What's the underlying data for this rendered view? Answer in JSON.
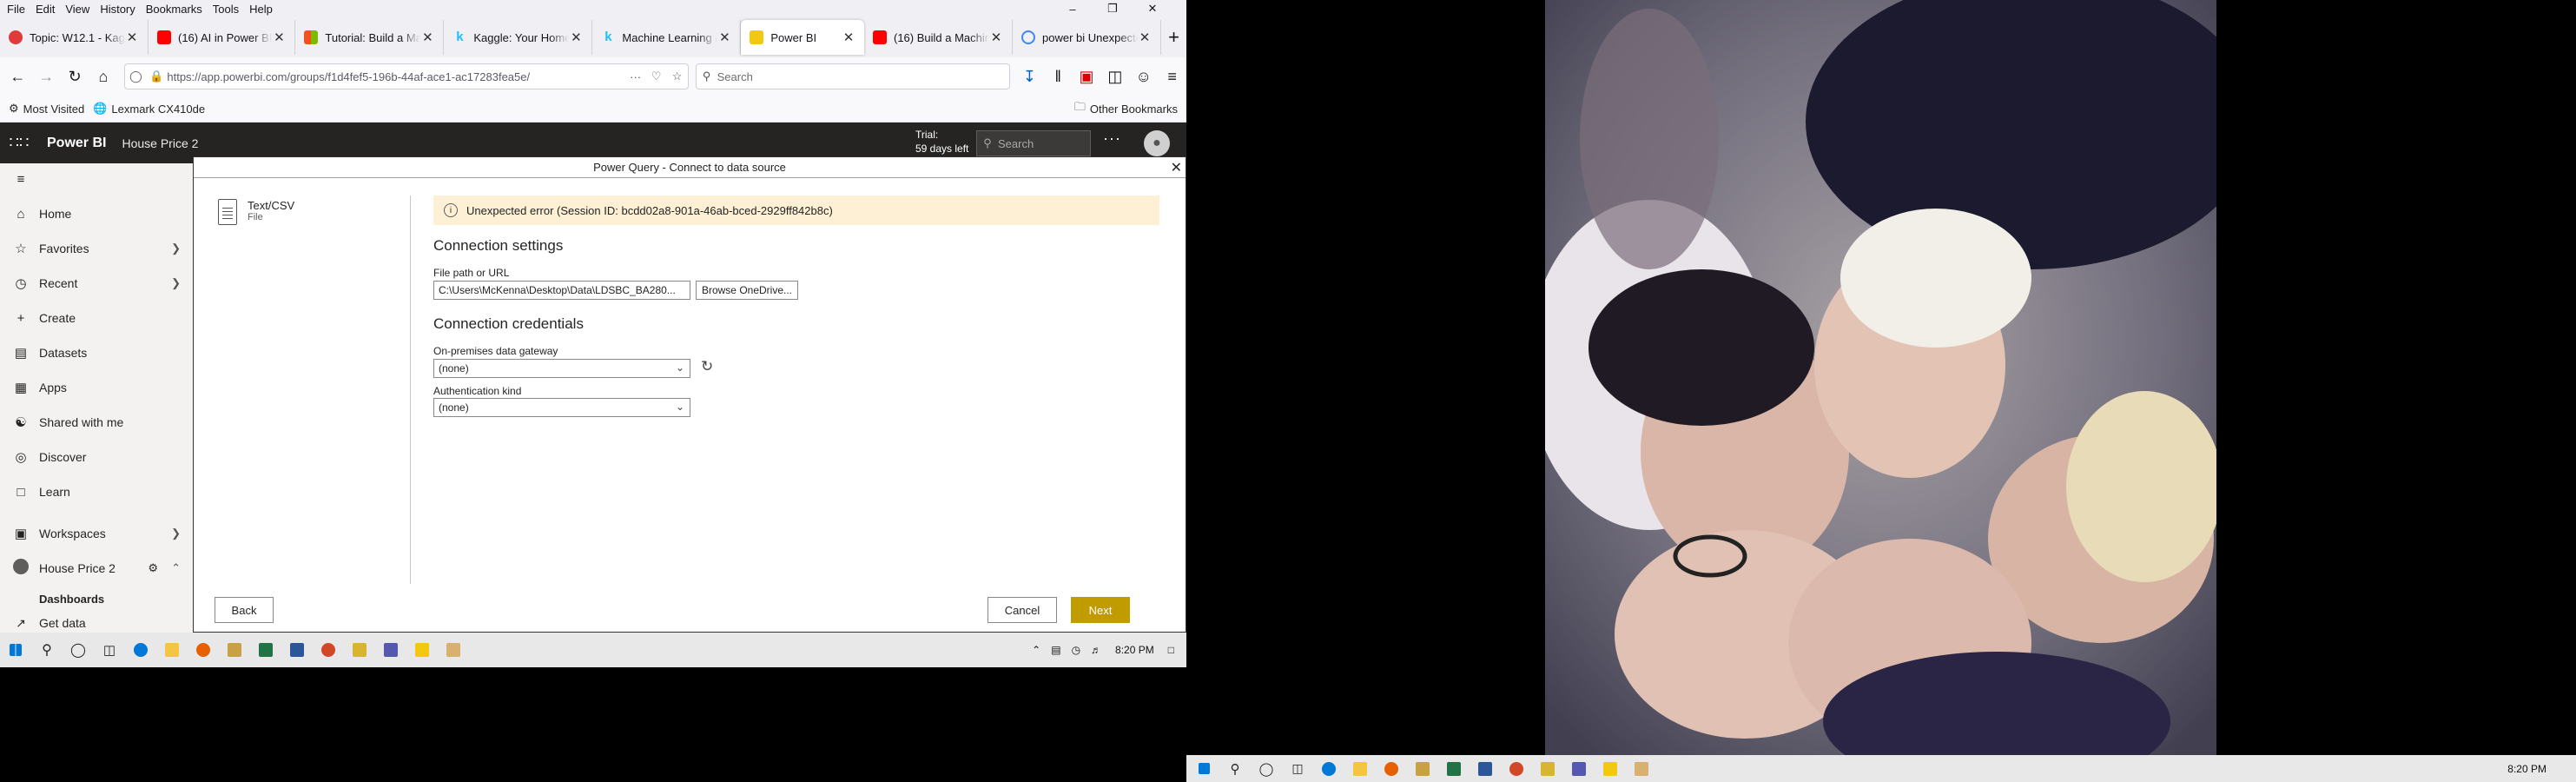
{
  "browser": {
    "menu": [
      "File",
      "Edit",
      "View",
      "History",
      "Bookmarks",
      "Tools",
      "Help"
    ],
    "window_controls": {
      "minimize": "–",
      "restore": "❐",
      "close": "✕"
    },
    "tabs": [
      {
        "label": "Topic: W12.1 - Kaggle",
        "favicon_color": "#e03a3a",
        "active": false
      },
      {
        "label": "(16) AI in Power BI",
        "favicon_color": "#ff0000",
        "active": false
      },
      {
        "label": "Tutorial: Build a Ma",
        "favicon_color": "#f25022",
        "active": false
      },
      {
        "label": "Kaggle: Your Home",
        "favicon_color": "#20beff",
        "active": false
      },
      {
        "label": "Machine Learning &",
        "favicon_color": "#20beff",
        "active": false
      },
      {
        "label": "Power BI",
        "favicon_color": "#f2c811",
        "active": true
      },
      {
        "label": "(16) Build a Machin",
        "favicon_color": "#ff0000",
        "active": false
      },
      {
        "label": "power bi Unexpecte",
        "favicon_color": "#4285f4",
        "active": false
      }
    ],
    "tab_close": "✕",
    "new_tab": "+",
    "url": "https://app.powerbi.com/groups/f1d4fef5-196b-44af-ace1-ac17283fea5e/",
    "url_domain": "powerbi.com",
    "search_placeholder": "Search",
    "bookmarks": [
      "Most Visited",
      "Lexmark CX410de"
    ],
    "other_bookmarks": "Other Bookmarks"
  },
  "powerbi": {
    "app_name": "Power BI",
    "workspace": "House Price 2",
    "trial_line1": "Trial:",
    "trial_line2": "59 days left",
    "search_placeholder": "Search",
    "more": "···",
    "nav": [
      {
        "label": "Home",
        "icon": "home-icon"
      },
      {
        "label": "Favorites",
        "icon": "star-icon",
        "chevron": true
      },
      {
        "label": "Recent",
        "icon": "clock-icon",
        "chevron": true
      },
      {
        "label": "Create",
        "icon": "plus-icon"
      },
      {
        "label": "Datasets",
        "icon": "dataset-icon"
      },
      {
        "label": "Apps",
        "icon": "apps-icon"
      },
      {
        "label": "Shared with me",
        "icon": "shared-icon"
      },
      {
        "label": "Discover",
        "icon": "discover-icon"
      },
      {
        "label": "Learn",
        "icon": "learn-icon"
      },
      {
        "label": "Workspaces",
        "icon": "workspaces-icon",
        "chevron": true
      },
      {
        "label": "House Price 2",
        "icon": "workspace-avatar-icon"
      },
      {
        "label": "Dashboards",
        "icon": ""
      },
      {
        "label": "Get data",
        "icon": "get-data-icon"
      }
    ]
  },
  "dialog": {
    "title": "Power Query - Connect to data source",
    "close": "✕",
    "connector_name": "Text/CSV",
    "connector_type": "File",
    "error": "Unexpected error (Session ID: bcdd02a8-901a-46ab-bced-2929ff842b8c)",
    "error_icon": "i",
    "connection_settings": "Connection settings",
    "file_path_label": "File path or URL",
    "file_path_value": "C:\\Users\\McKenna\\Desktop\\Data\\LDSBC_BA280...",
    "browse_button": "Browse OneDrive...",
    "connection_credentials": "Connection credentials",
    "gateway_label": "On-premises data gateway",
    "gateway_value": "(none)",
    "auth_label": "Authentication kind",
    "auth_value": "(none)",
    "back_button": "Back",
    "cancel_button": "Cancel",
    "next_button": "Next",
    "accent_color": "#c19c00"
  },
  "taskbar_left": {
    "time": "8:20 PM"
  },
  "taskbar_right": {
    "time": "8:20 PM"
  }
}
